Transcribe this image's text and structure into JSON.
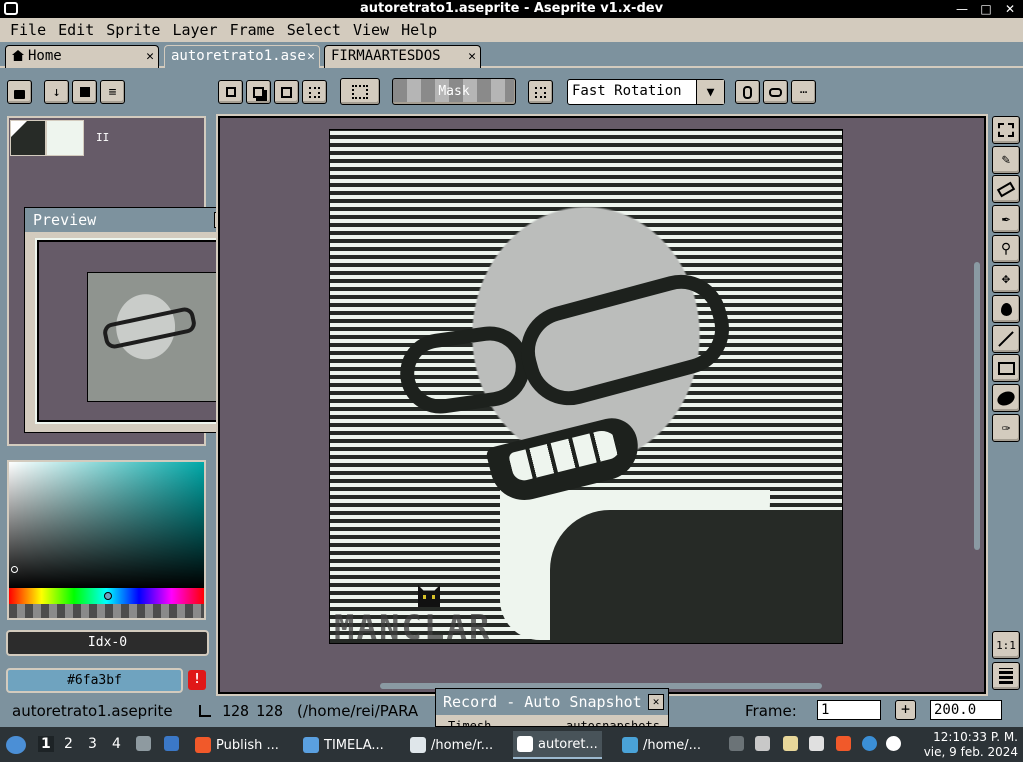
{
  "window": {
    "title": "autoretrato1.aseprite - Aseprite v1.x-dev",
    "controls": [
      "—",
      "□",
      "✕"
    ]
  },
  "menu": [
    "File",
    "Edit",
    "Sprite",
    "Layer",
    "Frame",
    "Select",
    "View",
    "Help"
  ],
  "tabs": [
    {
      "label": "Home",
      "icon": "home-icon",
      "close": "✕"
    },
    {
      "label": "autoretrato1.ase",
      "close": "✕"
    },
    {
      "label": "FIRMAARTESDOS",
      "close": "✕"
    }
  ],
  "toolbar": {
    "mask_label": "Mask",
    "rotation": "Fast Rotation"
  },
  "palette": {
    "pause": "II"
  },
  "preview": {
    "title": "Preview"
  },
  "color": {
    "idx": "Idx-0",
    "hex": "#6fa3bf",
    "hex_color": "#6fa3bf",
    "warn": "!"
  },
  "canvas": {
    "signature": "MANCLAR"
  },
  "status": {
    "file": "autoretrato1.aseprite",
    "width": "128",
    "height": "128",
    "path": "(/home/rei/PARA",
    "frame_label": "Frame:",
    "frame_value": "1",
    "plus": "+",
    "zoom": "200.0"
  },
  "tools_bottom": {
    "one_to_one": "1:1"
  },
  "record": {
    "title": "Record - Auto Snapshot",
    "close": "✕",
    "sub_left": "Timesh",
    "sub_right": "autosnapshots"
  },
  "taskbar": {
    "workspaces": [
      "1",
      "2",
      "3",
      "4"
    ],
    "apps": [
      {
        "label": "Publish ...",
        "icon": "brave-icon"
      },
      {
        "label": "TIMELA...",
        "icon": "folder-icon"
      },
      {
        "label": "/home/r...",
        "icon": "editor-icon"
      },
      {
        "label": "autoret...",
        "icon": "aseprite-icon"
      },
      {
        "label": "/home/...",
        "icon": "image-viewer-icon"
      }
    ],
    "clock_time": "12:10:33 P. M.",
    "clock_date": "vie, 9 feb. 2024"
  }
}
